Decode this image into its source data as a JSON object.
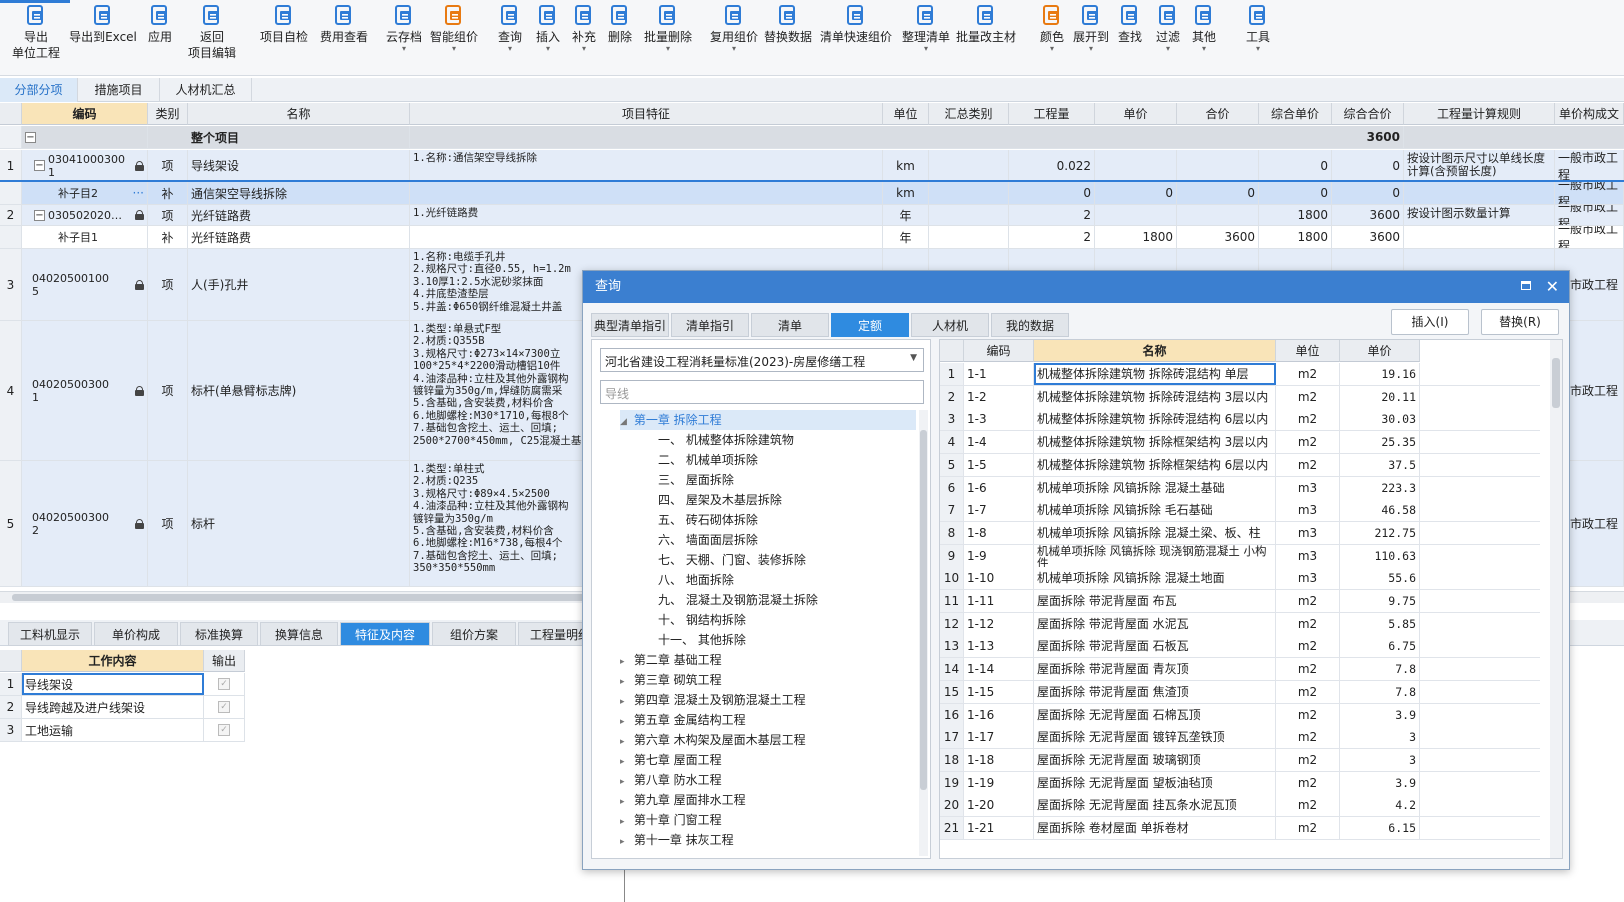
{
  "toolbar": {
    "buttons": [
      {
        "label": "导出\n单位工程",
        "icon": "export-unit-icon"
      },
      {
        "label": "导出到Excel",
        "icon": "export-excel-icon"
      },
      {
        "label": "应用",
        "icon": "apply-icon"
      },
      {
        "label": "返回\n项目编辑",
        "icon": "return-icon"
      },
      {
        "label": "项目自检",
        "icon": "check-icon"
      },
      {
        "label": "费用查看",
        "icon": "cost-view-icon"
      },
      {
        "label": "云存档",
        "icon": "cloud-save-icon"
      },
      {
        "label": "智能组价",
        "icon": "smart-price-icon"
      },
      {
        "label": "查询",
        "icon": "query-icon"
      },
      {
        "label": "插入",
        "icon": "insert-icon"
      },
      {
        "label": "补充",
        "icon": "supplement-icon"
      },
      {
        "label": "删除",
        "icon": "delete-icon"
      },
      {
        "label": "批量删除",
        "icon": "batch-delete-icon"
      },
      {
        "label": "复用组价",
        "icon": "reuse-price-icon"
      },
      {
        "label": "替换数据",
        "icon": "replace-data-icon"
      },
      {
        "label": "清单快速组价",
        "icon": "quick-price-icon"
      },
      {
        "label": "整理清单",
        "icon": "organize-list-icon"
      },
      {
        "label": "批量改主材",
        "icon": "batch-material-icon"
      },
      {
        "label": "颜色",
        "icon": "color-icon"
      },
      {
        "label": "展开到",
        "icon": "expand-icon"
      },
      {
        "label": "查找",
        "icon": "find-icon"
      },
      {
        "label": "过滤",
        "icon": "filter-icon"
      },
      {
        "label": "其他",
        "icon": "other-icon"
      },
      {
        "label": "工具",
        "icon": "tools-icon"
      }
    ]
  },
  "tabs": [
    "分部分项",
    "措施项目",
    "人材机汇总"
  ],
  "grid": {
    "headers": [
      "编码",
      "类别",
      "名称",
      "项目特征",
      "单位",
      "汇总类别",
      "工程量",
      "单价",
      "合价",
      "综合单价",
      "综合合价",
      "工程量计算规则",
      "单价构成文"
    ],
    "whole_project": {
      "label": "整个项目",
      "total": "3600"
    },
    "rows": [
      {
        "num": "1",
        "code": "03041000300\n1",
        "cat": "项",
        "name": "导线架设",
        "feature": "1.名称:通信架空导线拆除",
        "unit": "km",
        "qty": "0.022",
        "price": "",
        "sum": "",
        "uprice": "0",
        "usum": "0",
        "rule": "按设计图示尺寸以单线长度计算(含预留长度)",
        "compose": "一般市政工程"
      },
      {
        "num": "",
        "code": "补子目2",
        "cat": "补",
        "name": "通信架空导线拆除",
        "feature": "",
        "unit": "km",
        "qty": "0",
        "price": "0",
        "sum": "0",
        "uprice": "0",
        "usum": "0",
        "rule": "",
        "compose": "一般市政工程"
      },
      {
        "num": "2",
        "code": "030502020…",
        "cat": "项",
        "name": "光纤链路费",
        "feature": "1.光纤链路费",
        "unit": "年",
        "qty": "2",
        "price": "",
        "sum": "",
        "uprice": "1800",
        "usum": "3600",
        "rule": "按设计图示数量计算",
        "compose": "一般市政工程"
      },
      {
        "num": "",
        "code": "补子目1",
        "cat": "补",
        "name": "光纤链路费",
        "feature": "",
        "unit": "年",
        "qty": "2",
        "price": "1800",
        "sum": "3600",
        "uprice": "1800",
        "usum": "3600",
        "rule": "",
        "compose": "一般市政工程"
      },
      {
        "num": "3",
        "code": "04020500100\n5",
        "cat": "项",
        "name": "人(手)孔井",
        "feature": "1.名称:电缆手孔井\n2.规格尺寸:直径0.55, h=1.2m\n3.10厚1:2.5水泥砂浆抹面\n4.井底垫渣垫层\n5.井盖:Φ650钢纤维混凝土井盖",
        "unit": "",
        "qty": "",
        "price": "",
        "sum": "",
        "uprice": "",
        "usum": "",
        "rule": "",
        "compose": "般市政工程"
      },
      {
        "num": "4",
        "code": "04020500300\n1",
        "cat": "项",
        "name": "标杆(单悬臂标志牌)",
        "feature": "1.类型:单悬式F型\n2.材质:Q355B\n3.规格尺寸:Φ273×14×7300立\n100*25*4*2200滑动槽铝10件\n4.油漆品种:立柱及其他外露钢构\n镀锌量为350g/m,焊缝防腐需采\n5.含基础,含安装费,材料价含\n6.地脚螺栓:M30*1710,每根8个\n7.基础包含挖土、运土、回填;\n2500*2700*450mm, C25混凝土基",
        "unit": "",
        "qty": "",
        "price": "",
        "sum": "",
        "uprice": "",
        "usum": "",
        "rule": "",
        "compose": "般市政工程"
      },
      {
        "num": "5",
        "code": "04020500300\n2",
        "cat": "项",
        "name": "标杆",
        "feature": "1.类型:单柱式\n2.材质:Q235\n3.规格尺寸:Φ89×4.5×2500\n4.油漆品种:立柱及其他外露钢构\n镀锌量为350g/m\n5.含基础,含安装费,材料价含\n6.地脚螺栓:M16*738,每根4个\n7.基础包含挖土、运土、回填;\n350*350*550mm",
        "unit": "",
        "qty": "",
        "price": "",
        "sum": "",
        "uprice": "",
        "usum": "",
        "rule": "",
        "compose": "般市政工程"
      }
    ]
  },
  "bottom_tabs": [
    "工料机显示",
    "单价构成",
    "标准换算",
    "换算信息",
    "特征及内容",
    "组价方案",
    "工程量明细"
  ],
  "work": {
    "headers": [
      "工作内容",
      "输出"
    ],
    "rows": [
      "导线架设",
      "导线跨越及进户线架设",
      "工地运输"
    ]
  },
  "dialog": {
    "title": "查询",
    "tabs": [
      "典型清单指引",
      "清单指引",
      "清单",
      "定额",
      "人材机",
      "我的数据"
    ],
    "insert_btn": "插入(I)",
    "replace_btn": "替换(R)",
    "library": "河北省建设工程消耗量标准(2023)-房屋修缮工程",
    "search_placeholder": "导线",
    "tree": [
      {
        "label": "第一章 拆除工程",
        "level": 0,
        "open": true,
        "active": true
      },
      {
        "label": "一、 机械整体拆除建筑物",
        "level": 1
      },
      {
        "label": "二、 机械单项拆除",
        "level": 1
      },
      {
        "label": "三、 屋面拆除",
        "level": 1
      },
      {
        "label": "四、 屋架及木基层拆除",
        "level": 1
      },
      {
        "label": "五、 砖石砌体拆除",
        "level": 1
      },
      {
        "label": "六、 墙面面层拆除",
        "level": 1
      },
      {
        "label": "七、 天棚、门窗、装修拆除",
        "level": 1
      },
      {
        "label": "八、 地面拆除",
        "level": 1
      },
      {
        "label": "九、 混凝土及钢筋混凝土拆除",
        "level": 1
      },
      {
        "label": "十、 钢结构拆除",
        "level": 1
      },
      {
        "label": "十一、 其他拆除",
        "level": 1
      },
      {
        "label": "第二章 基础工程",
        "level": 0
      },
      {
        "label": "第三章 砌筑工程",
        "level": 0
      },
      {
        "label": "第四章 混凝土及钢筋混凝土工程",
        "level": 0
      },
      {
        "label": "第五章 金属结构工程",
        "level": 0
      },
      {
        "label": "第六章 木构架及屋面木基层工程",
        "level": 0
      },
      {
        "label": "第七章 屋面工程",
        "level": 0
      },
      {
        "label": "第八章 防水工程",
        "level": 0
      },
      {
        "label": "第九章 屋面排水工程",
        "level": 0
      },
      {
        "label": "第十章 门窗工程",
        "level": 0
      },
      {
        "label": "第十一章 抹灰工程",
        "level": 0
      }
    ],
    "result_headers": [
      "编码",
      "名称",
      "单位",
      "单价"
    ],
    "results": [
      {
        "n": "1",
        "code": "1-1",
        "name": "机械整体拆除建筑物 拆除砖混结构 单层",
        "unit": "m2",
        "price": "19.16"
      },
      {
        "n": "2",
        "code": "1-2",
        "name": "机械整体拆除建筑物 拆除砖混结构 3层以内",
        "unit": "m2",
        "price": "20.11"
      },
      {
        "n": "3",
        "code": "1-3",
        "name": "机械整体拆除建筑物 拆除砖混结构 6层以内",
        "unit": "m2",
        "price": "30.03"
      },
      {
        "n": "4",
        "code": "1-4",
        "name": "机械整体拆除建筑物 拆除框架结构 3层以内",
        "unit": "m2",
        "price": "25.35"
      },
      {
        "n": "5",
        "code": "1-5",
        "name": "机械整体拆除建筑物 拆除框架结构 6层以内",
        "unit": "m2",
        "price": "37.5"
      },
      {
        "n": "6",
        "code": "1-6",
        "name": "机械单项拆除 风镐拆除 混凝土基础",
        "unit": "m3",
        "price": "223.3"
      },
      {
        "n": "7",
        "code": "1-7",
        "name": "机械单项拆除 风镐拆除 毛石基础",
        "unit": "m3",
        "price": "46.58"
      },
      {
        "n": "8",
        "code": "1-8",
        "name": "机械单项拆除 风镐拆除 混凝土梁、板、柱",
        "unit": "m3",
        "price": "212.75"
      },
      {
        "n": "9",
        "code": "1-9",
        "name": "机械单项拆除 风镐拆除 现浇钢筋混凝土 小构件",
        "unit": "m3",
        "price": "110.63"
      },
      {
        "n": "10",
        "code": "1-10",
        "name": "机械单项拆除 风镐拆除 混凝土地面",
        "unit": "m3",
        "price": "55.6"
      },
      {
        "n": "11",
        "code": "1-11",
        "name": "屋面拆除 带泥背屋面 布瓦",
        "unit": "m2",
        "price": "9.75"
      },
      {
        "n": "12",
        "code": "1-12",
        "name": "屋面拆除 带泥背屋面 水泥瓦",
        "unit": "m2",
        "price": "5.85"
      },
      {
        "n": "13",
        "code": "1-13",
        "name": "屋面拆除 带泥背屋面 石板瓦",
        "unit": "m2",
        "price": "6.75"
      },
      {
        "n": "14",
        "code": "1-14",
        "name": "屋面拆除 带泥背屋面 青灰顶",
        "unit": "m2",
        "price": "7.8"
      },
      {
        "n": "15",
        "code": "1-15",
        "name": "屋面拆除 带泥背屋面 焦渣顶",
        "unit": "m2",
        "price": "7.8"
      },
      {
        "n": "16",
        "code": "1-16",
        "name": "屋面拆除 无泥背屋面 石棉瓦顶",
        "unit": "m2",
        "price": "3.9"
      },
      {
        "n": "17",
        "code": "1-17",
        "name": "屋面拆除 无泥背屋面 镀锌瓦垄铁顶",
        "unit": "m2",
        "price": "3"
      },
      {
        "n": "18",
        "code": "1-18",
        "name": "屋面拆除 无泥背屋面 玻璃钢顶",
        "unit": "m2",
        "price": "3"
      },
      {
        "n": "19",
        "code": "1-19",
        "name": "屋面拆除 无泥背屋面 望板油毡顶",
        "unit": "m2",
        "price": "3.9"
      },
      {
        "n": "20",
        "code": "1-20",
        "name": "屋面拆除 无泥背屋面 挂瓦条水泥瓦顶",
        "unit": "m2",
        "price": "4.2"
      },
      {
        "n": "21",
        "code": "1-21",
        "name": "屋面拆除 卷材屋面 单拆卷材",
        "unit": "m2",
        "price": "6.15"
      }
    ]
  }
}
